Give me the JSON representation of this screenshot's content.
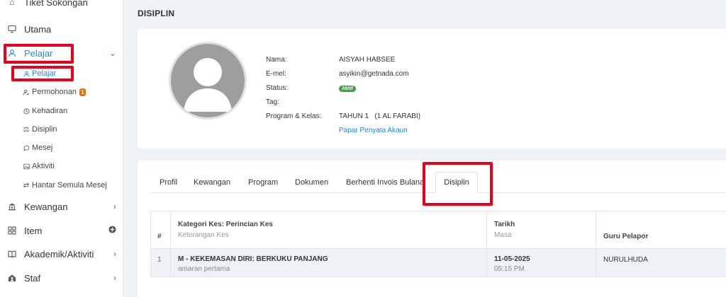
{
  "sidebar": {
    "items": [
      {
        "label": "Tiket Sokongan",
        "icon": "ticket-icon"
      },
      {
        "label": "Utama",
        "icon": "monitor-icon"
      },
      {
        "label": "Pelajar",
        "icon": "user-icon"
      },
      {
        "label": "Kewangan",
        "icon": "bank-icon"
      },
      {
        "label": "Item",
        "icon": "grid-icon"
      },
      {
        "label": "Akademik/Aktiviti",
        "icon": "book-icon"
      },
      {
        "label": "Staf",
        "icon": "staff-icon"
      }
    ],
    "subitems": [
      {
        "label": "Pelajar",
        "icon": "user-icon"
      },
      {
        "label": "Permohonan",
        "icon": "user-check-icon",
        "badge": "1"
      },
      {
        "label": "Kehadiran",
        "icon": "clock-icon"
      },
      {
        "label": "Disiplin",
        "icon": "scale-icon"
      },
      {
        "label": "Mesej",
        "icon": "chat-icon"
      },
      {
        "label": "Aktiviti",
        "icon": "image-icon"
      },
      {
        "label": "Hantar Semula Mesej",
        "icon": "resend-icon"
      }
    ]
  },
  "page": {
    "title": "DISIPLIN"
  },
  "profile": {
    "labels": {
      "name": "Nama:",
      "email": "E-mel:",
      "status": "Status:",
      "tag": "Tag:",
      "program": "Program & Kelas:"
    },
    "values": {
      "name": "AISYAH HABSEE",
      "email": "asyikin@getnada.com",
      "status": "Aktif",
      "program": "TAHUN 1   (1 AL FARABI)",
      "statement_link": "Papar Penyata Akaun"
    }
  },
  "tabs": [
    "Profil",
    "Kewangan",
    "Program",
    "Dokumen",
    "Berhenti Invois Bulanan",
    "Disiplin"
  ],
  "active_tab": "Disiplin",
  "table": {
    "headers": {
      "num": "#",
      "category": "Kategori Kes: Perincian Kes",
      "category_sub": "Keterangan Kes",
      "date": "Tarikh",
      "date_sub": "Masa",
      "teacher": "Guru Pelapor"
    },
    "rows": [
      {
        "num": "1",
        "category": "M - KEKEMASAN DIRI: BERKUKU PANJANG",
        "description": "amaran pertama",
        "date": "11-05-2025",
        "time": "05:15 PM",
        "teacher": "NURULHUDA"
      }
    ]
  },
  "colors": {
    "accent": "#1e88e5",
    "highlight": "#e8001c",
    "status": "#43a047",
    "badge": "#ef6c00"
  }
}
